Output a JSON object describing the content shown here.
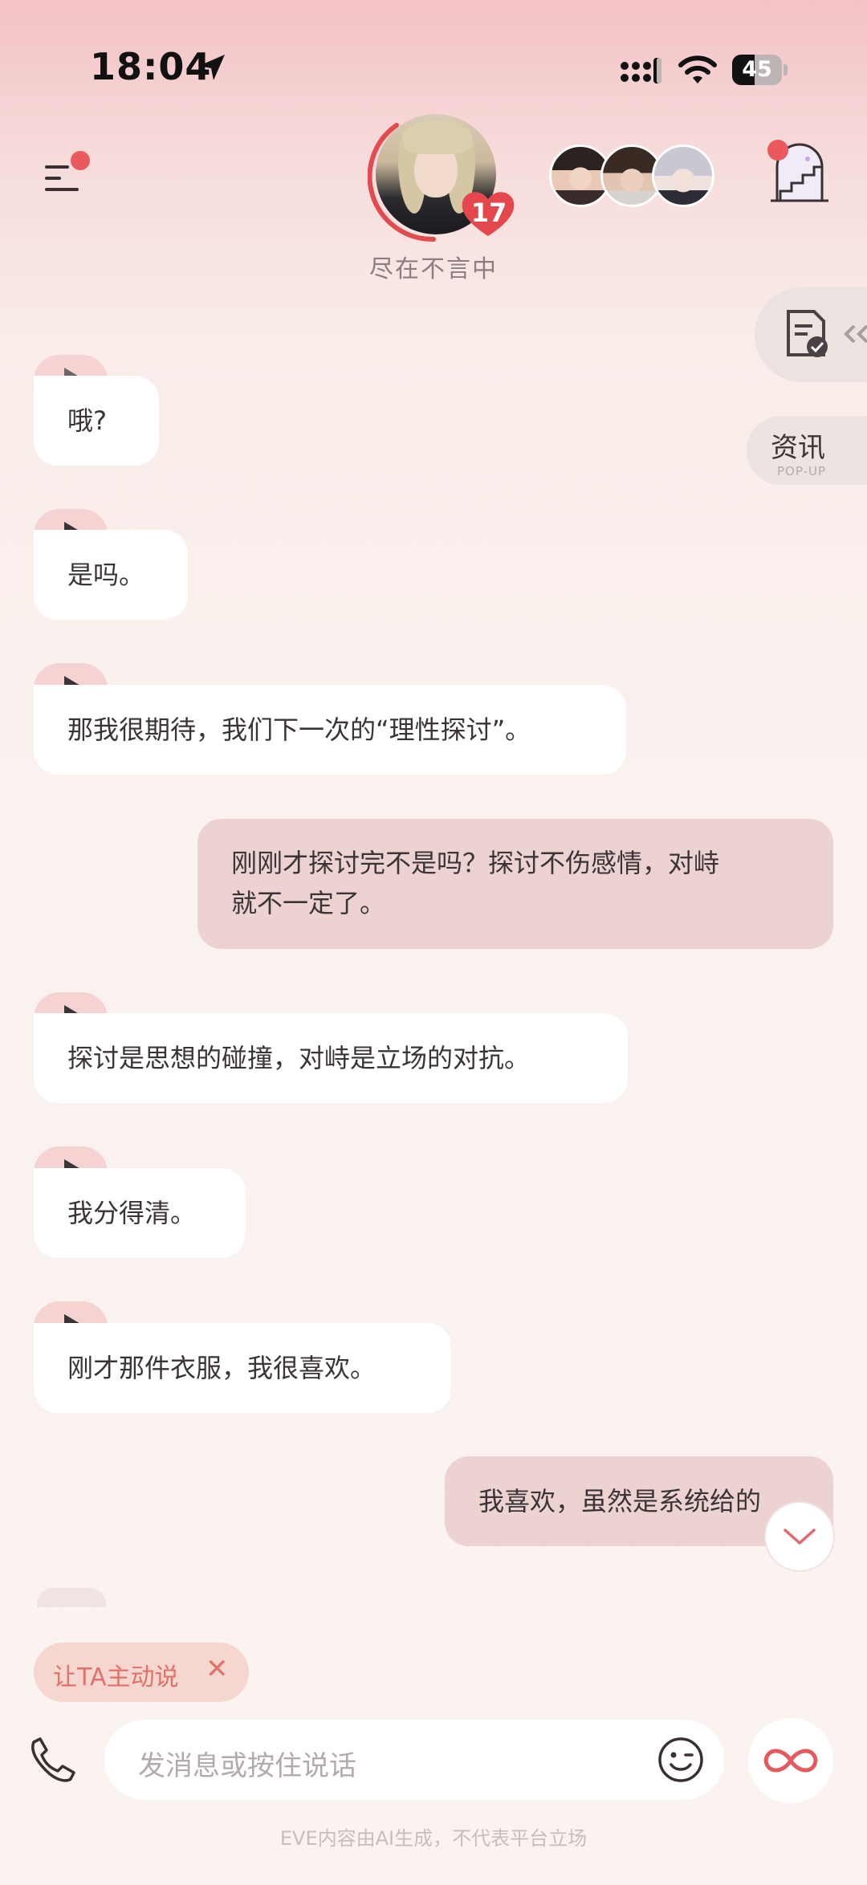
{
  "status_bar": {
    "time": "18:04",
    "battery": "45",
    "battery_level": 0.45
  },
  "header": {
    "intimacy_level": "17",
    "character_status": "尽在不言中",
    "icons": {
      "menu": "menu-icon",
      "room": "staircase-room-icon"
    }
  },
  "side": {
    "news_label": "资讯",
    "news_sub": "POP-UP"
  },
  "messages": [
    {
      "from": "ai",
      "text": "哦?"
    },
    {
      "from": "ai",
      "text": "是吗。"
    },
    {
      "from": "ai",
      "text": "那我很期待，我们下一次的“理性探讨”。"
    },
    {
      "from": "user",
      "lines": [
        "刚刚才探讨完不是吗？探讨不伤感情，对峙",
        "就不一定了。"
      ]
    },
    {
      "from": "ai",
      "text": "探讨是思想的碰撞，对峙是立场的对抗。"
    },
    {
      "from": "ai",
      "text": "我分得清。"
    },
    {
      "from": "ai",
      "text": "刚才那件衣服，我很喜欢。"
    },
    {
      "from": "user",
      "text": "我喜欢，虽然是系统给的"
    }
  ],
  "composer": {
    "suggestion": "让TA主动说",
    "close_glyph": "✕",
    "placeholder": "发消息或按住说话",
    "footer": "EVE内容由AI生成，不代表平台立场"
  },
  "colors": {
    "accent_red": "#ea5a5c",
    "user_bubble": "#ecd2d1",
    "ai_bubble": "#ffffff",
    "suggestion_text": "#e0716b"
  }
}
